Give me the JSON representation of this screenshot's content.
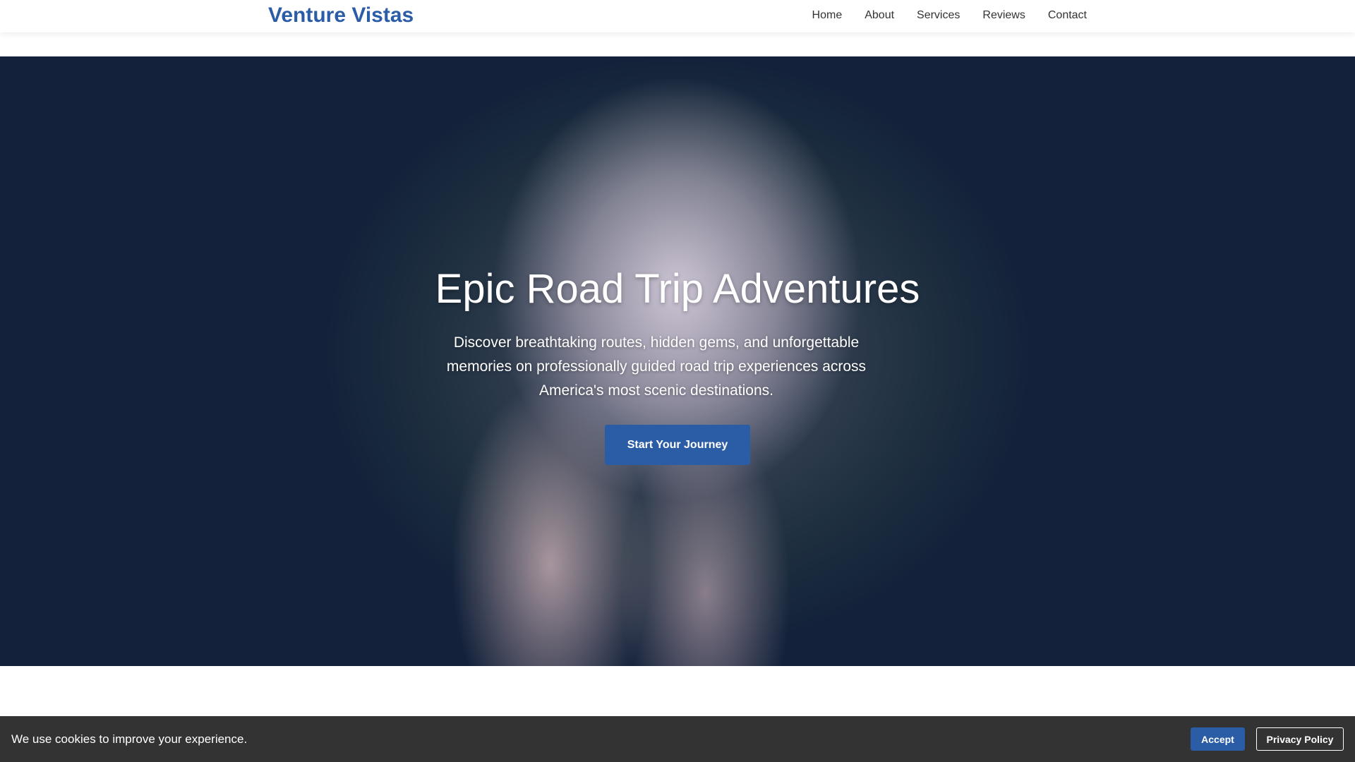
{
  "nav": {
    "logo": "Venture Vistas",
    "links": [
      "Home",
      "About",
      "Services",
      "Reviews",
      "Contact"
    ]
  },
  "hero": {
    "title": "Epic Road Trip Adventures",
    "subtitle": "Discover breathtaking routes, hidden gems, and unforgettable memories on professionally guided road trip experiences across America's most scenic destinations.",
    "cta": "Start Your Journey"
  },
  "cookie": {
    "message": "We use cookies to improve your experience.",
    "accept": "Accept",
    "privacy": "Privacy Policy"
  }
}
